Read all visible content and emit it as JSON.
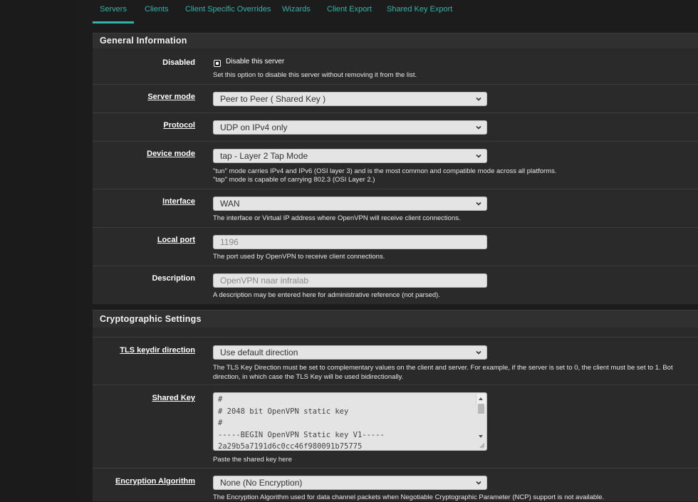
{
  "tabs": [
    "Servers",
    "Clients",
    "Client Specific Overrides",
    "Wizards",
    "Client Export",
    "Shared Key Export"
  ],
  "general": {
    "title": "General Information",
    "disabled": {
      "label": "Disabled",
      "checkbox_label": "Disable this server",
      "help": "Set this option to disable this server without removing it from the list."
    },
    "server_mode": {
      "label": "Server mode",
      "value": "Peer to Peer ( Shared Key )"
    },
    "protocol": {
      "label": "Protocol",
      "value": "UDP on IPv4 only"
    },
    "device_mode": {
      "label": "Device mode",
      "value": "tap - Layer 2 Tap Mode",
      "help1": "\"tun\" mode carries IPv4 and IPv6 (OSI layer 3) and is the most common and compatible mode across all platforms.",
      "help2": "\"tap\" mode is capable of carrying 802.3 (OSI Layer 2.)"
    },
    "interface": {
      "label": "Interface",
      "value": "WAN",
      "help": "The interface or Virtual IP address where OpenVPN will receive client connections."
    },
    "local_port": {
      "label": "Local port",
      "value": "1196",
      "help": "The port used by OpenVPN to receive client connections."
    },
    "description": {
      "label": "Description",
      "value": "OpenVPN naar infralab",
      "help": "A description may be entered here for administrative reference (not parsed)."
    }
  },
  "crypto": {
    "title": "Cryptographic Settings",
    "tls_keydir": {
      "label": "TLS keydir direction",
      "value": "Use default direction",
      "help1": "The TLS Key Direction must be set to complementary values on the client and server. For example, if the server is set to 0, the client must be set to 1. Bot",
      "help2": "direction, in which case the TLS Key will be used bidirectionally."
    },
    "shared_key": {
      "label": "Shared Key",
      "lines": [
        "#",
        "# 2048 bit OpenVPN static key",
        "#",
        "-----BEGIN OpenVPN Static key V1-----",
        "2a29b5a7191d6c0cc46f980091b75775"
      ],
      "help": "Paste the shared key here"
    },
    "encryption": {
      "label": "Encryption Algorithm",
      "value": "None (No Encryption)",
      "help": "The Encryption Algorithm used for data channel packets when Negotiable Cryptographic Parameter (NCP) support is not available."
    }
  },
  "icons": {
    "dropdown": "chevron-down-icon",
    "checkbox": "checkbox-icon"
  }
}
